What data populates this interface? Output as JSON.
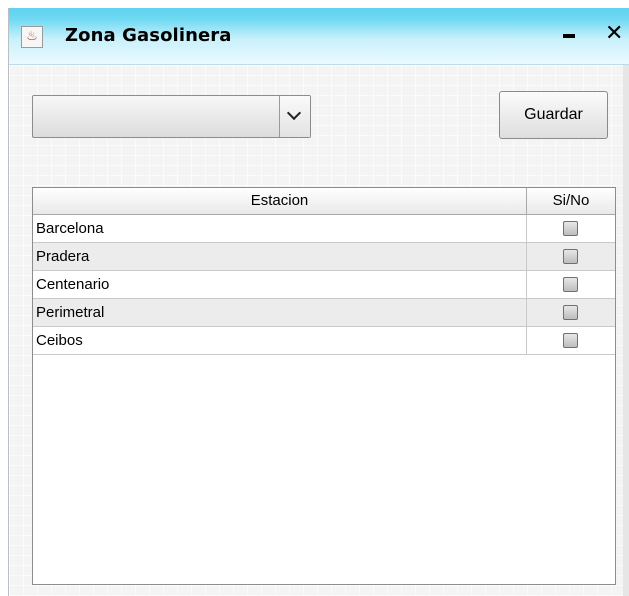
{
  "window": {
    "title": "Zona Gasolinera",
    "app_icon": "java-cup-icon",
    "minimize_label": "–",
    "close_label": "✕"
  },
  "form": {
    "combo_value": "",
    "save_label": "Guardar"
  },
  "table": {
    "columns": [
      "Estacion",
      "Si/No"
    ],
    "rows": [
      {
        "name": "Barcelona",
        "checked": false
      },
      {
        "name": "Pradera",
        "checked": false
      },
      {
        "name": "Centenario",
        "checked": false
      },
      {
        "name": "Perimetral",
        "checked": false
      },
      {
        "name": "Ceibos",
        "checked": false
      }
    ]
  }
}
